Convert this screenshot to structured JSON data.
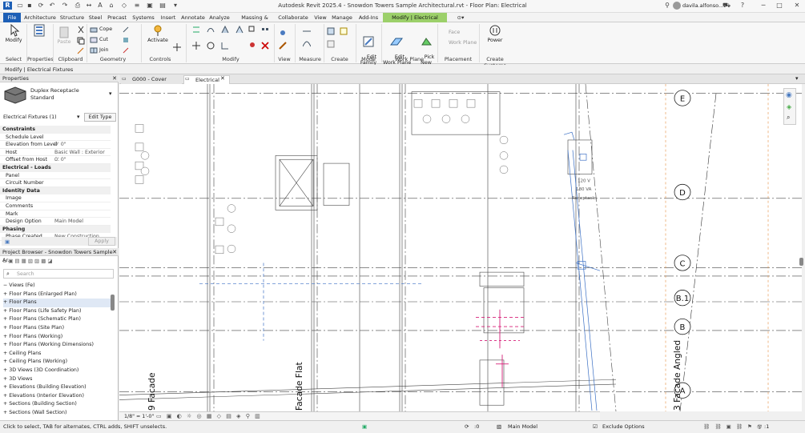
{
  "titlebar": {
    "title": "Autodesk Revit 2025.4 - Snowdon Towers Sample Architectural.rvt - Floor Plan: Electrical",
    "user": "davila.alfonso..."
  },
  "ribbon_tabs": [
    {
      "label": "File"
    },
    {
      "label": "Architecture"
    },
    {
      "label": "Structure"
    },
    {
      "label": "Steel"
    },
    {
      "label": "Precast"
    },
    {
      "label": "Systems"
    },
    {
      "label": "Insert"
    },
    {
      "label": "Annotate"
    },
    {
      "label": "Analyze"
    },
    {
      "label": "Massing & Site"
    },
    {
      "label": "Collaborate"
    },
    {
      "label": "View"
    },
    {
      "label": "Manage"
    },
    {
      "label": "Add-Ins"
    },
    {
      "label": "Modify | Electrical Fixtures"
    }
  ],
  "ribbon": {
    "modify": "Modify",
    "cope": "Cope",
    "cut": "Cut",
    "join": "Join",
    "activate": "Activate",
    "edit_family": "Edit\nFamily",
    "edit_work_plane": "Edit\nWork Plane",
    "pick_new": "Pick\nNew",
    "face": "Face",
    "work_plane_btn": "Work Plane",
    "power": "Power",
    "groups": {
      "select": "Select",
      "properties": "Properties",
      "clipboard": "Clipboard",
      "geometry": "Geometry",
      "controls": "Controls",
      "modify": "Modify",
      "view": "View",
      "measure": "Measure",
      "create": "Create",
      "mode": "Mode",
      "work_plane": "Work Plane",
      "placement": "Placement",
      "create_systems": "Create Systems"
    }
  },
  "context_bar": "Modify | Electrical Fixtures",
  "properties": {
    "header": "Properties",
    "family": "Duplex Receptacle",
    "type": "Standard",
    "filter": "Electrical Fixtures (1)",
    "edit_type": "Edit Type",
    "apply": "Apply",
    "rows": [
      {
        "section": "Constraints"
      },
      {
        "k": "Schedule Level",
        "v": ""
      },
      {
        "k": "Elevation from Level",
        "v": "0'  0\""
      },
      {
        "k": "Host",
        "v": "Basic Wall : Exterior ..."
      },
      {
        "k": "Offset from Host",
        "v": "0'  0\""
      },
      {
        "section": "Electrical - Loads"
      },
      {
        "k": "Panel",
        "v": ""
      },
      {
        "k": "Circuit Number",
        "v": ""
      },
      {
        "section": "Identity Data"
      },
      {
        "k": "Image",
        "v": ""
      },
      {
        "k": "Comments",
        "v": ""
      },
      {
        "k": "Mark",
        "v": ""
      },
      {
        "k": "Design Option",
        "v": "Main Model"
      },
      {
        "section": "Phasing"
      },
      {
        "k": "Phase Created",
        "v": "New Construction"
      }
    ]
  },
  "browser": {
    "header": "Project Browser - Snowdon Towers Sample Ar...",
    "search_placeholder": "Search",
    "items": [
      "Views (Fe)",
      "Floor Plans (Enlarged Plan)",
      "Floor Plans",
      "Floor Plans (Life Safety Plan)",
      "Floor Plans (Schematic Plan)",
      "Floor Plans (Site Plan)",
      "Floor Plans (Working)",
      "Floor Plans (Working Dimensions)",
      "Ceiling Plans",
      "Ceiling Plans (Working)",
      "3D Views (3D Coordination)",
      "3D Views",
      "Elevations (Building Elevation)",
      "Elevations (Interior Elevation)",
      "Sections (Building Section)",
      "Sections (Wall Section)"
    ]
  },
  "doc_tabs": [
    {
      "label": "G000 - Cover"
    },
    {
      "label": "Electrical"
    }
  ],
  "grid_labels": [
    "E",
    "D",
    "C",
    "B.1",
    "B",
    "A"
  ],
  "drawing_text": {
    "volt": "120 V",
    "va": "180 VA",
    "recept": "Receptacle",
    "facade1": "9 Facade",
    "facade2": "Facade Flat",
    "facade3": "3 Facade Angled"
  },
  "view_control": {
    "scale": "1/8\" = 1'-0\""
  },
  "status": {
    "hint": "Click to select, TAB for alternates, CTRL adds, SHIFT unselects.",
    "zero": ":0",
    "model": "Main Model",
    "exclude": "Exclude Options",
    "filter": ":1"
  }
}
